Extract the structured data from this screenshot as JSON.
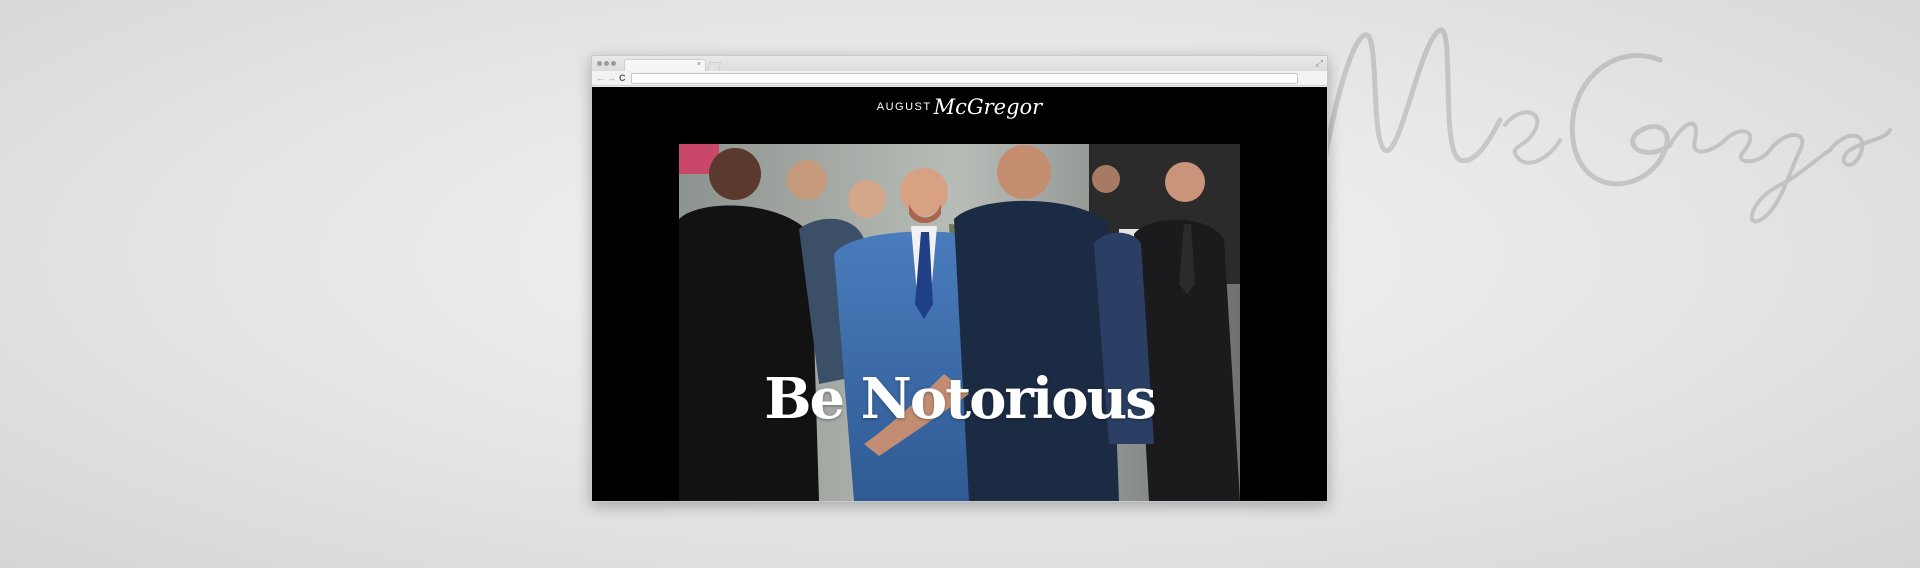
{
  "background": {
    "script_text": "McGregor"
  },
  "browser": {
    "tab_close_glyph": "×",
    "back_glyph": "←",
    "forward_glyph": "→",
    "reload_glyph": "C",
    "expand_glyph": "⤢",
    "address_value": ""
  },
  "site": {
    "logo_word": "AUGUST",
    "logo_script": "McGregor",
    "hero_title": "Be Notorious"
  },
  "colors": {
    "page_background": "#000000",
    "hero_text": "#ffffff",
    "suit_blue": "#3f6fae",
    "shirt_navy": "#1c2b44"
  },
  "icons": [
    "close-icon",
    "back-arrow-icon",
    "forward-arrow-icon",
    "reload-icon",
    "expand-icon"
  ]
}
